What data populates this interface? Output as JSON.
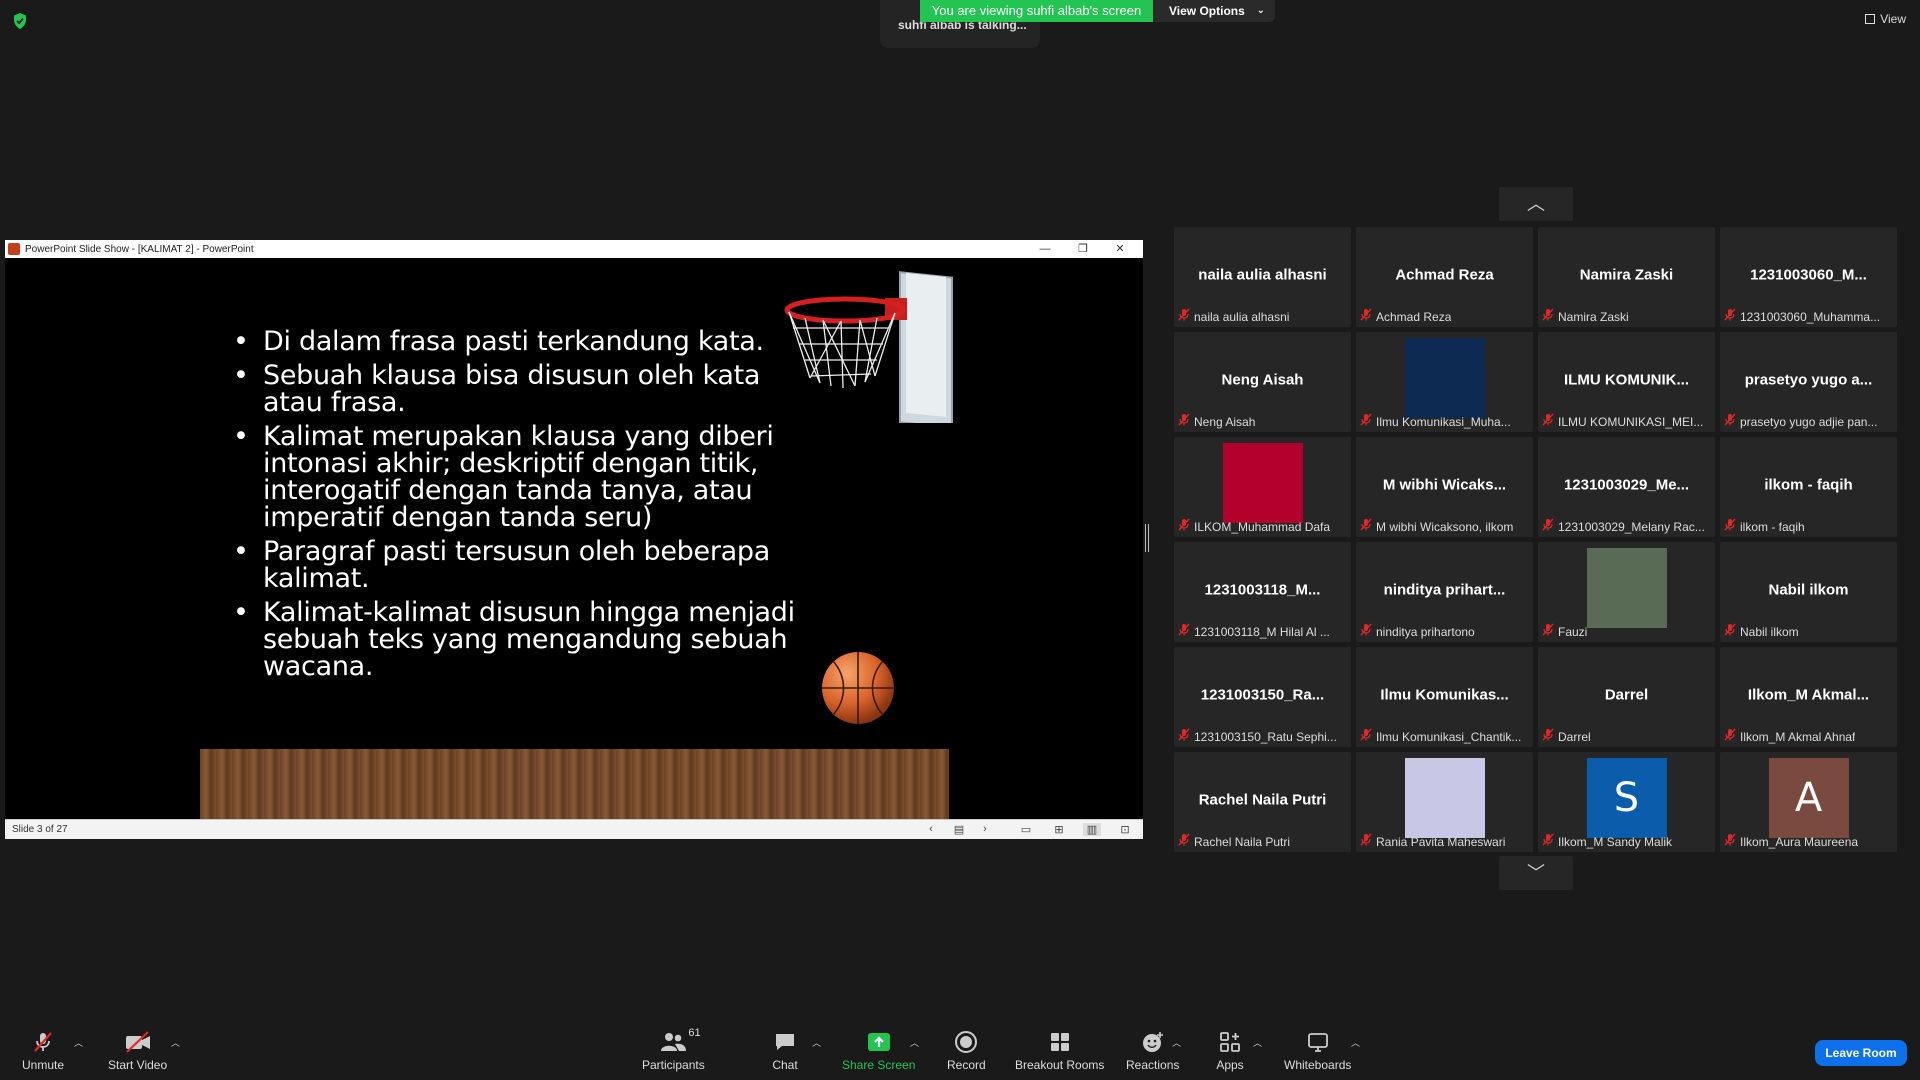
{
  "top": {
    "talking_text": "suhfi albab is talking...",
    "viewing_text": "You are viewing suhfi albab's screen",
    "view_options_label": "View Options",
    "view_label": "View"
  },
  "ppt": {
    "window_title": "PowerPoint Slide Show - [KALIMAT 2] - PowerPoint",
    "bullets": [
      "Di dalam frasa pasti terkandung kata.",
      "Sebuah klausa bisa disusun oleh kata atau frasa.",
      "Kalimat merupakan klausa yang diberi intonasi akhir; deskriptif dengan titik, interogatif dengan tanda tanya, atau imperatif dengan tanda seru)",
      "Paragraf pasti tersusun oleh beberapa kalimat.",
      "Kalimat-kalimat disusun hingga menjadi sebuah teks yang mengandung sebuah wacana."
    ],
    "slide_counter": "Slide 3 of 27"
  },
  "participants": [
    {
      "big": "naila aulia alhasni",
      "name": "naila aulia alhasni"
    },
    {
      "big": "Achmad Reza",
      "name": "Achmad Reza"
    },
    {
      "big": "Namira Zaski",
      "name": "Namira Zaski"
    },
    {
      "big": "1231003060_M...",
      "name": "1231003060_Muhamma..."
    },
    {
      "big": "Neng Aisah",
      "name": "Neng Aisah"
    },
    {
      "big": "",
      "name": "Ilmu Komunikasi_Muha...",
      "video_color": "#0d2a52"
    },
    {
      "big": "ILMU KOMUNIK...",
      "name": "ILMU KOMUNIKASI_MEI..."
    },
    {
      "big": "prasetyo yugo a...",
      "name": "prasetyo yugo adjie pan..."
    },
    {
      "big": "",
      "name": "ILKOM_Muhammad Dafa",
      "video_color": "#b3002d"
    },
    {
      "big": "M wibhi Wicaks...",
      "name": "M wibhi Wicaksono, ilkom"
    },
    {
      "big": "1231003029_Me...",
      "name": "1231003029_Melany Rac..."
    },
    {
      "big": "ilkom - faqih",
      "name": "ilkom - faqih"
    },
    {
      "big": "1231003118_M...",
      "name": "1231003118_M Hilal Al ..."
    },
    {
      "big": "ninditya prihart...",
      "name": "ninditya prihartono"
    },
    {
      "big": "",
      "name": "Fauzi",
      "video_color": "#5a6b55"
    },
    {
      "big": "Nabil ilkom",
      "name": "Nabil ilkom"
    },
    {
      "big": "1231003150_Ra...",
      "name": "1231003150_Ratu Sephi..."
    },
    {
      "big": "Ilmu Komunikas...",
      "name": "Ilmu Komunikasi_Chantik..."
    },
    {
      "big": "Darrel",
      "name": "Darrel"
    },
    {
      "big": "Ilkom_M Akmal...",
      "name": "Ilkom_M Akmal Ahnaf"
    },
    {
      "big": "Rachel Naila Putri",
      "name": "Rachel Naila Putri"
    },
    {
      "big": "",
      "name": "Rania Pavita Maheswari",
      "video_color": "#c8c7e6"
    },
    {
      "big": "",
      "name": "Ilkom_M Sandy Malik",
      "avatar_letter": "S",
      "video_color": "#0b5cab"
    },
    {
      "big": "",
      "name": "Ilkom_Aura Maureena",
      "avatar_letter": "A",
      "video_color": "#7a4a3e"
    }
  ],
  "toolbar": {
    "unmute": "Unmute",
    "start_video": "Start Video",
    "participants": "Participants",
    "participants_count": "61",
    "chat": "Chat",
    "share_screen": "Share Screen",
    "record": "Record",
    "breakout_rooms": "Breakout Rooms",
    "reactions": "Reactions",
    "apps": "Apps",
    "whiteboards": "Whiteboards",
    "leave_room": "Leave Room"
  },
  "colors": {
    "share_green": "#23c552",
    "leave_blue": "#0e71eb",
    "mic_off_red": "#e02828"
  }
}
